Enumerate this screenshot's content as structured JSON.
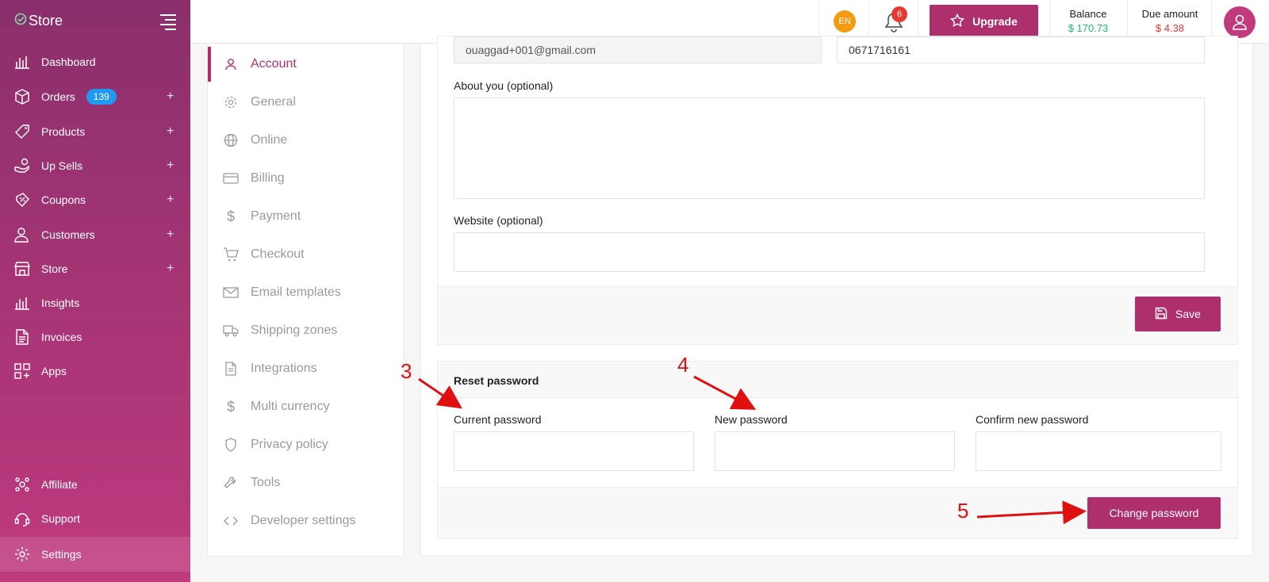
{
  "app": {
    "name": "Store"
  },
  "sidebar": {
    "items": [
      {
        "label": "Dashboard",
        "icon": "chart-bar-icon"
      },
      {
        "label": "Orders",
        "icon": "box-icon",
        "badge": "139",
        "expandable": true
      },
      {
        "label": "Products",
        "icon": "tag-icon",
        "expandable": true
      },
      {
        "label": "Up Sells",
        "icon": "hand-coins-icon",
        "expandable": true
      },
      {
        "label": "Coupons",
        "icon": "coupon-icon",
        "expandable": true
      },
      {
        "label": "Customers",
        "icon": "users-icon",
        "expandable": true
      },
      {
        "label": "Store",
        "icon": "storefront-icon",
        "expandable": true
      },
      {
        "label": "Insights",
        "icon": "chart-bar-icon"
      },
      {
        "label": "Invoices",
        "icon": "document-icon"
      },
      {
        "label": "Apps",
        "icon": "apps-grid-icon"
      }
    ],
    "bottom_items": [
      {
        "label": "Affiliate",
        "icon": "affiliate-icon"
      },
      {
        "label": "Support",
        "icon": "headset-icon"
      },
      {
        "label": "Settings",
        "icon": "gear-icon",
        "active": true
      }
    ]
  },
  "topbar": {
    "language": "EN",
    "notifications_count": "6",
    "upgrade_label": "Upgrade",
    "balance_label": "Balance",
    "balance_value": "$ 170.73",
    "due_label": "Due amount",
    "due_value": "$ 4.38",
    "balance_color": "#1bbf6b",
    "due_color": "#e53935"
  },
  "settings_nav": {
    "items": [
      {
        "label": "Account",
        "icon": "user-icon",
        "active": true
      },
      {
        "label": "General",
        "icon": "gear-icon"
      },
      {
        "label": "Online",
        "icon": "globe-icon"
      },
      {
        "label": "Billing",
        "icon": "credit-card-icon"
      },
      {
        "label": "Payment",
        "icon": "dollar-icon"
      },
      {
        "label": "Checkout",
        "icon": "cart-icon"
      },
      {
        "label": "Email templates",
        "icon": "mail-icon"
      },
      {
        "label": "Shipping zones",
        "icon": "truck-icon"
      },
      {
        "label": "Integrations",
        "icon": "document-icon"
      },
      {
        "label": "Multi currency",
        "icon": "dollar-icon"
      },
      {
        "label": "Privacy policy",
        "icon": "shield-icon"
      },
      {
        "label": "Tools",
        "icon": "wrench-icon"
      },
      {
        "label": "Developer settings",
        "icon": "code-icon"
      }
    ]
  },
  "account_form": {
    "email_value": "ouaggad+001@gmail.com",
    "phone_value": "0671716161",
    "about_label": "About you (optional)",
    "about_value": "",
    "website_label": "Website (optional)",
    "website_value": "",
    "save_label": "Save"
  },
  "reset_password": {
    "title": "Reset password",
    "current_label": "Current password",
    "new_label": "New password",
    "confirm_label": "Confirm new password",
    "button_label": "Change password"
  },
  "annotations": {
    "step_3": "3",
    "step_4": "4",
    "step_5": "5",
    "color": "#e01010"
  },
  "colors": {
    "accent": "#ad2f6b",
    "sidebar_top": "#8a2f6b",
    "sidebar_bottom": "#bf3a7f"
  }
}
